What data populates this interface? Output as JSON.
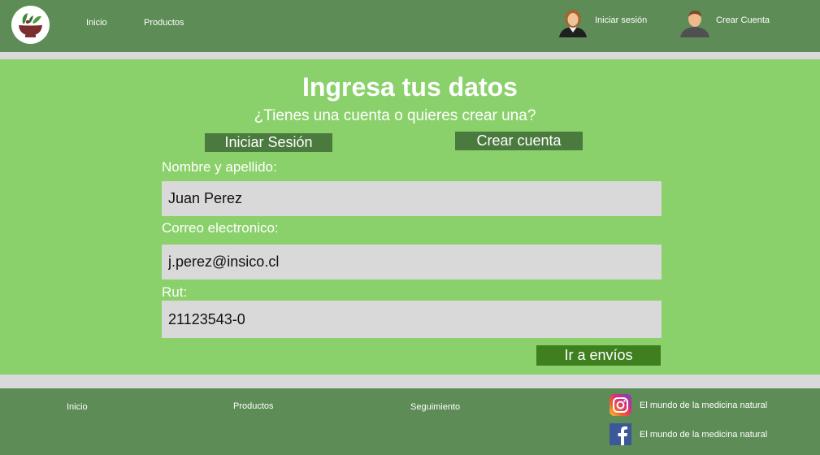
{
  "header": {
    "nav": {
      "home_label": "Inicio",
      "products_label": "Productos"
    },
    "login_label": "Iniciar sesión",
    "register_label": "Crear Cuenta"
  },
  "form": {
    "title": "Ingresa tus datos",
    "subtitle": "¿Tienes una cuenta o quieres crear una?",
    "login_tab_label": "Iniciar Sesión",
    "register_tab_label": "Crear cuenta",
    "name_label": "Nombre y apellido:",
    "name_value": "Juan Perez",
    "email_label": "Correo electronico:",
    "email_value": "j.perez@insico.cl",
    "rut_label": "Rut:",
    "rut_value": "21123543-0",
    "submit_label": "Ir a envíos"
  },
  "footer": {
    "home_label": "Inicio",
    "products_label": "Productos",
    "tracking_label": "Seguimiento",
    "instagram_text": "El mundo de la medicina natural",
    "facebook_text": "El mundo de la medicina natural"
  },
  "colors": {
    "header_bg": "#5d8c56",
    "main_bg": "#8bd16b",
    "button_dark": "#4a7a3e",
    "submit_bg": "#3f7f1f",
    "input_bg": "#d9d9d9"
  },
  "icons": {
    "logo": "herb-mortar-logo",
    "login": "user-female-icon",
    "register": "user-male-icon",
    "instagram": "instagram-icon",
    "facebook": "facebook-icon"
  }
}
